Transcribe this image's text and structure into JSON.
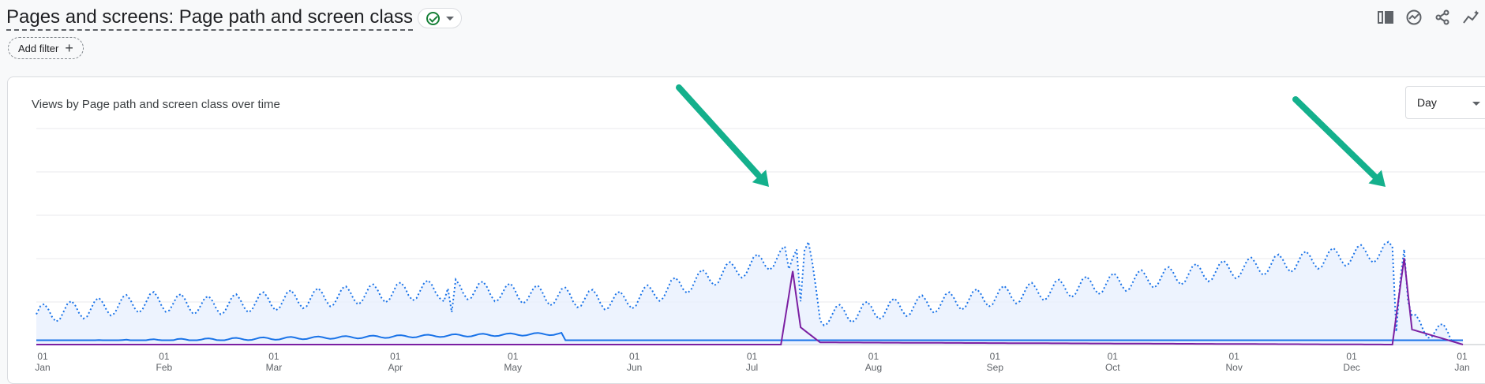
{
  "header": {
    "title": "Pages and screens: Page path and screen class",
    "add_filter_label": "Add filter"
  },
  "toolbar": {
    "icons": [
      "compare-columns-icon",
      "insights-icon",
      "share-icon",
      "customize-chart-icon"
    ]
  },
  "chart": {
    "title": "Views by Page path and screen class over time",
    "granularity": "Day",
    "x_ticks": [
      {
        "day": "01",
        "month": "Jan"
      },
      {
        "day": "01",
        "month": "Feb"
      },
      {
        "day": "01",
        "month": "Mar"
      },
      {
        "day": "01",
        "month": "Apr"
      },
      {
        "day": "01",
        "month": "May"
      },
      {
        "day": "01",
        "month": "Jun"
      },
      {
        "day": "01",
        "month": "Jul"
      },
      {
        "day": "01",
        "month": "Aug"
      },
      {
        "day": "01",
        "month": "Sep"
      },
      {
        "day": "01",
        "month": "Oct"
      },
      {
        "day": "01",
        "month": "Nov"
      },
      {
        "day": "01",
        "month": "Dec"
      },
      {
        "day": "01",
        "month": "Jan"
      }
    ]
  },
  "chart_data": {
    "type": "line",
    "x_range": [
      "Jan 1",
      "Jan 1 (next year)"
    ],
    "grid": true,
    "series": [
      {
        "style": "dotted-area",
        "color": "#1a73e8",
        "notes_points": [
          [
            0,
            0.14
          ],
          [
            30,
            0.2
          ],
          [
            44,
            0.18
          ],
          [
            105,
            0.26
          ],
          [
            150,
            0.2
          ],
          [
            193,
            0.42
          ],
          [
            197,
            0.44
          ],
          [
            200,
            0.13
          ],
          [
            349,
            0.44
          ],
          [
            351,
            0.1
          ],
          [
            364,
            0.02
          ]
        ]
      },
      {
        "style": "solid",
        "color": "#7b1fa2",
        "notes_points": [
          [
            0,
            0
          ],
          [
            190,
            0
          ],
          [
            193,
            0.34
          ],
          [
            195,
            0.08
          ],
          [
            200,
            0.01
          ],
          [
            346,
            0
          ],
          [
            349,
            0.4
          ],
          [
            351,
            0.07
          ],
          [
            364,
            0
          ]
        ]
      },
      {
        "style": "solid",
        "color": "#1a73e8",
        "notes_points": [
          [
            0,
            0.01
          ],
          [
            134,
            0.05
          ],
          [
            135,
            0.01
          ],
          [
            364,
            0.01
          ]
        ]
      }
    ]
  },
  "annotations": [
    {
      "name": "arrow-july-spike",
      "color": "#14b08c"
    },
    {
      "name": "arrow-december-spike",
      "color": "#14b08c"
    }
  ]
}
